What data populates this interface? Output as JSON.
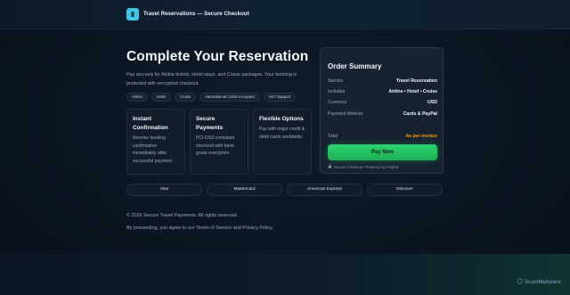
{
  "header": {
    "title": "Travel Reservations — Secure Checkout",
    "logo_icon": "ticket-icon"
  },
  "hero": {
    "title": "Complete Your Reservation",
    "lead": "Pay securely for Airline tickets, Hotel stays, and Cruise packages. Your booking is protected with encrypted checkout."
  },
  "chips": [
    "Airline",
    "Hotel",
    "Cruise",
    "International Cards Accepted",
    "24/7 Support"
  ],
  "features": [
    {
      "title": "Instant Confirmation",
      "body": "Receive booking confirmation immediately after successful payment."
    },
    {
      "title": "Secure Payments",
      "body": "PCI-DSS compliant checkout with bank-grade encryption."
    },
    {
      "title": "Flexible Options",
      "body": "Pay with major credit & debit cards worldwide."
    }
  ],
  "summary": {
    "title": "Order Summary",
    "rows": [
      {
        "label": "Service",
        "value": "Travel Reservation"
      },
      {
        "label": "Includes",
        "value": "Airline • Hotel • Cruise"
      },
      {
        "label": "Currency",
        "value": "USD"
      },
      {
        "label": "Payment Method",
        "value": "Cards & PayPal"
      }
    ],
    "total_label": "Total",
    "total_value": "As per invoice",
    "pay_button": "Pay Now",
    "secure_note": "Secure Checkout • Powered by PayPal"
  },
  "payment_methods": [
    "Visa",
    "Mastercard",
    "American Express",
    "Discover"
  ],
  "footer": {
    "copyright": "© 2026 Secure Travel Payments. All rights reserved.",
    "terms": "By proceeding, you agree to our Terms of Service and Privacy Policy."
  },
  "watermark": "ScanMalware",
  "colors": {
    "accent": "#3ec6e6",
    "pay_button": "#22c55e",
    "total": "#f59e0b",
    "background": "#0b1520"
  }
}
